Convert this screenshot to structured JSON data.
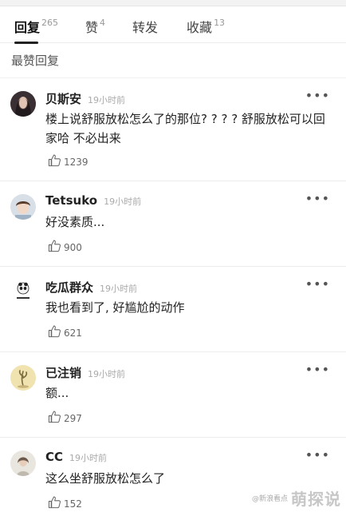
{
  "tabs": [
    {
      "label": "回复",
      "count": "265"
    },
    {
      "label": "赞",
      "count": "4"
    },
    {
      "label": "转发",
      "count": ""
    },
    {
      "label": "收藏",
      "count": "13"
    }
  ],
  "section_title": "最赞回复",
  "more_label": "•••",
  "comments": [
    {
      "name": "贝斯安",
      "time": "19小时前",
      "text": "楼上说舒服放松怎么了的那位? ? ? ? 舒服放松可以回家哈 不必出来",
      "likes": "1239"
    },
    {
      "name": "Tetsuko",
      "time": "19小时前",
      "text": "好没素质...",
      "likes": "900"
    },
    {
      "name": "吃瓜群众",
      "time": "19小时前",
      "text": "我也看到了, 好尴尬的动作",
      "likes": "621"
    },
    {
      "name": "已注销",
      "time": "19小时前",
      "text": "额...",
      "likes": "297"
    },
    {
      "name": "CC",
      "time": "19小时前",
      "text": "这么坐舒服放松怎么了",
      "likes": "152"
    }
  ],
  "watermark": {
    "small": "@新浪看点",
    "big": "萌探说"
  },
  "colors": {
    "background": "#ffffff",
    "text": "#222222",
    "muted": "#aaaaaa",
    "divider": "#ededed"
  }
}
